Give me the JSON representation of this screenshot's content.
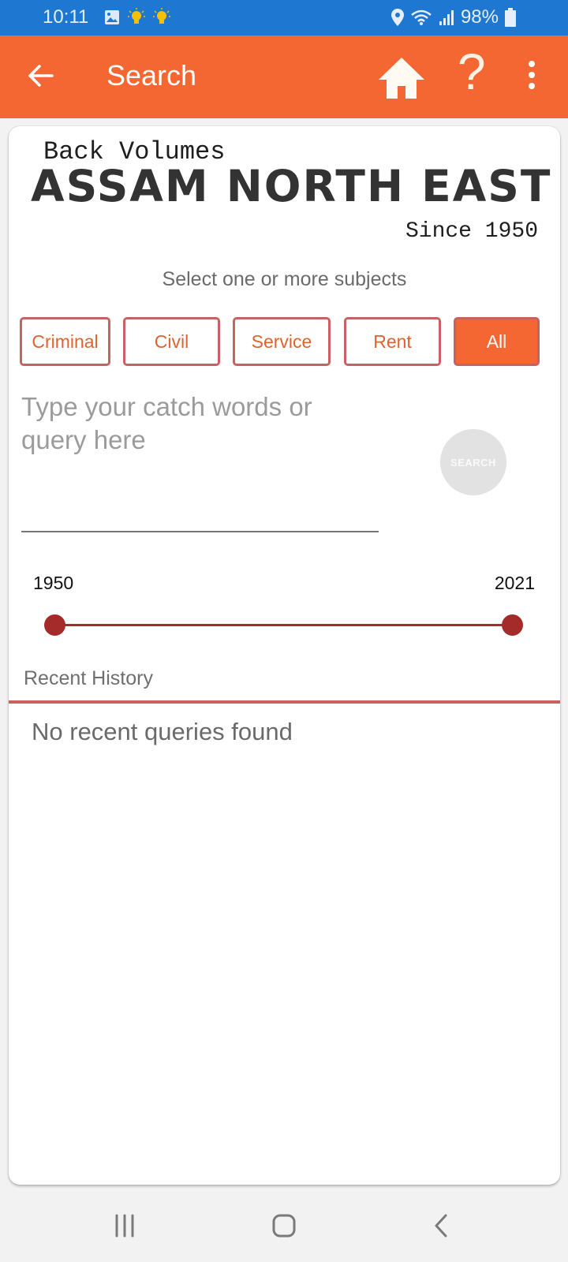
{
  "status_bar": {
    "time": "10:11",
    "left_icons": [
      "image-icon",
      "bulb-icon",
      "bulb-icon"
    ],
    "right_icons": [
      "location-icon",
      "wifi-icon",
      "signal-icon"
    ],
    "battery": "98%",
    "bulb_color": "#f5c000"
  },
  "app_bar": {
    "title": "Search",
    "back_icon": "arrow-back-icon",
    "home_icon": "home-icon",
    "help_label": "?",
    "more_icon": "more-vert-icon",
    "color": "#f46732"
  },
  "logo": {
    "top_line": "Back Volumes",
    "main": "ASSAM NORTH EAST",
    "since": "Since 1950"
  },
  "subjects": {
    "label": "Select one or more subjects",
    "chips": [
      {
        "label": "Criminal",
        "selected": false
      },
      {
        "label": "Civil",
        "selected": false
      },
      {
        "label": "Service",
        "selected": false
      },
      {
        "label": "Rent",
        "selected": false
      },
      {
        "label": "All",
        "selected": true
      }
    ]
  },
  "query": {
    "placeholder": "Type your catch words or query here",
    "value": "",
    "search_button": "SEARCH"
  },
  "year_range": {
    "min_label": "1950",
    "max_label": "2021",
    "min": 1950,
    "max": 2021,
    "selected_start": 1950,
    "selected_end": 2021
  },
  "history": {
    "label": "Recent History",
    "empty_text": "No recent queries found"
  },
  "nav_bar": {
    "recents": "recents-icon",
    "home": "home-nav-icon",
    "back": "back-nav-icon"
  }
}
